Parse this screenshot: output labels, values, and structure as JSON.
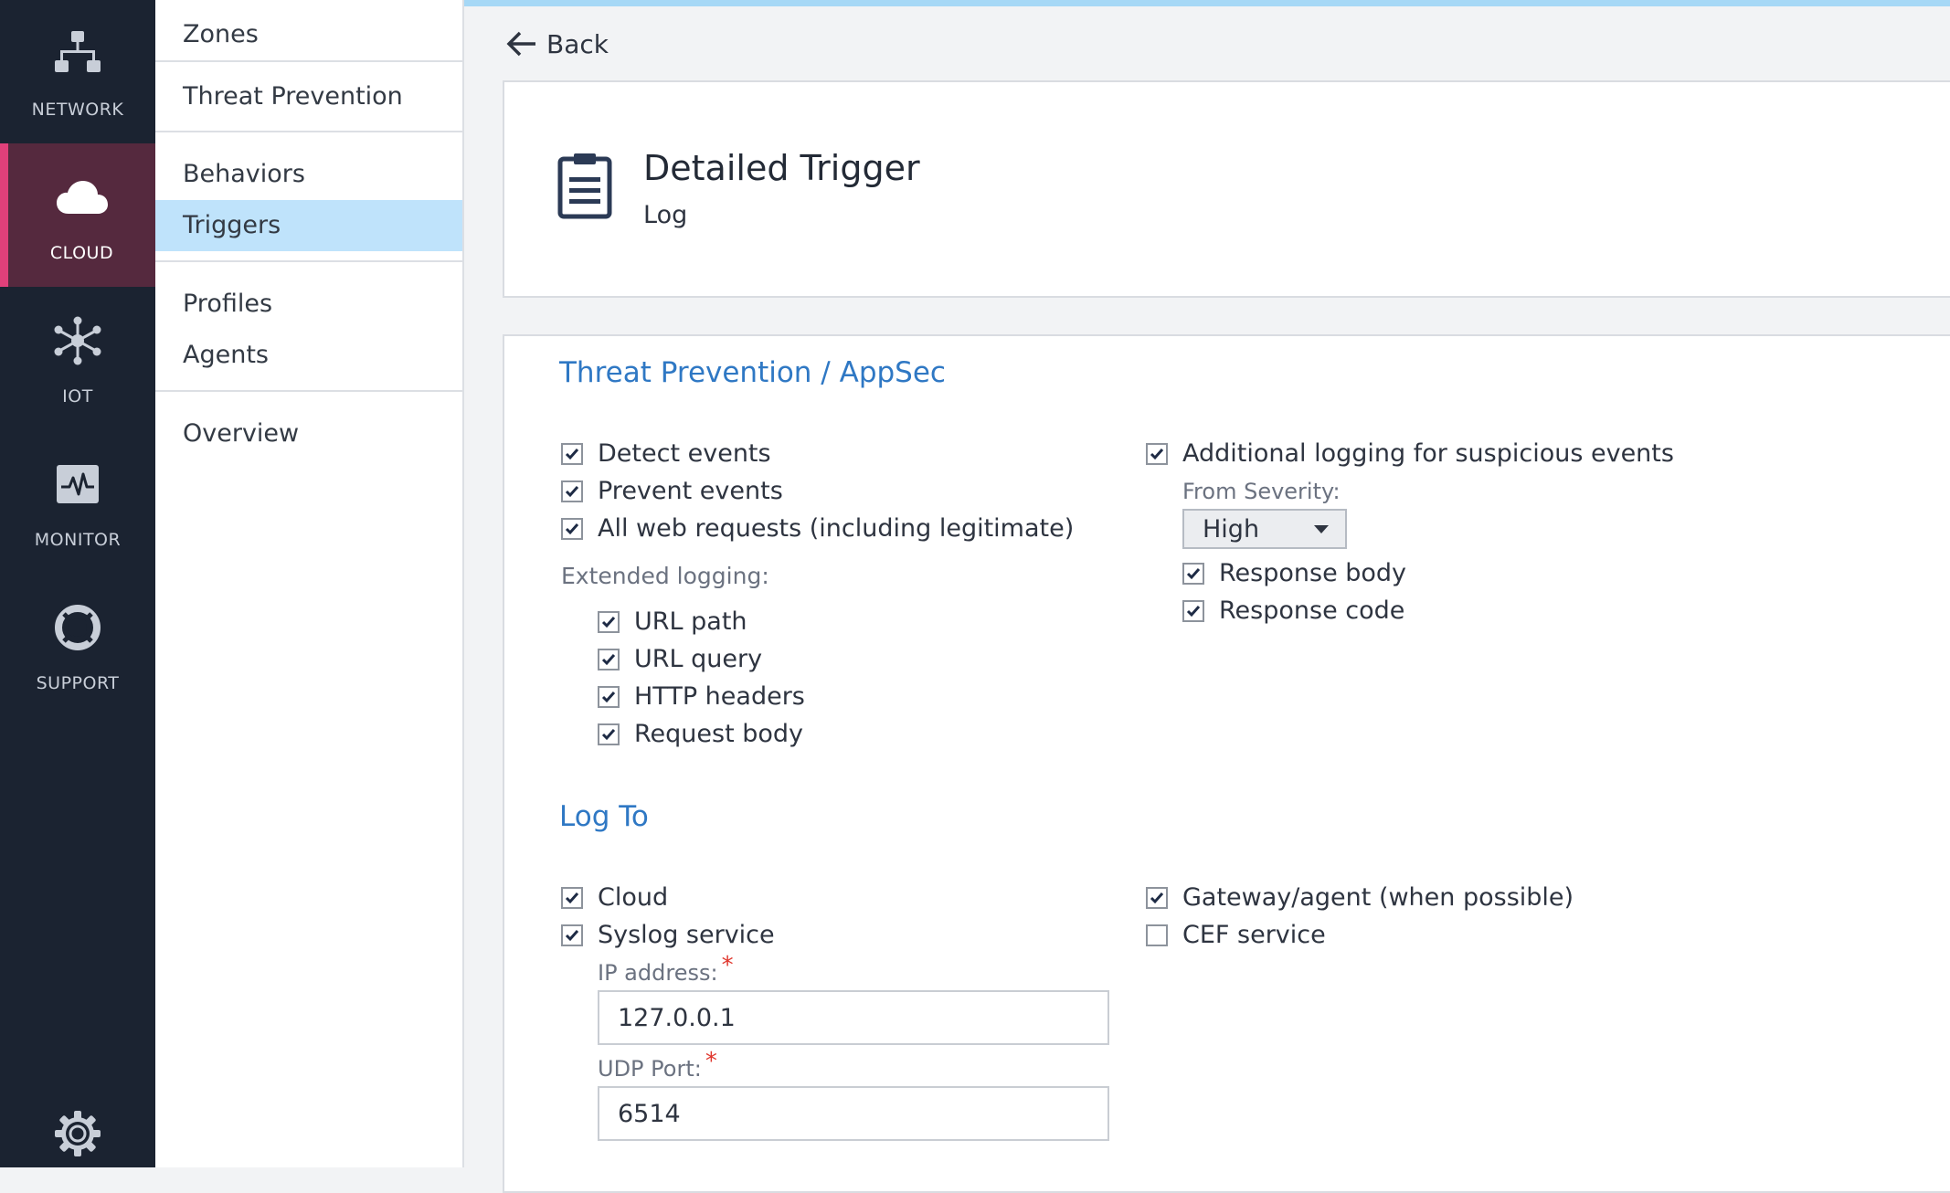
{
  "rail": {
    "items": [
      {
        "label": "NETWORK",
        "icon": "network-icon"
      },
      {
        "label": "CLOUD",
        "icon": "cloud-icon",
        "active": true
      },
      {
        "label": "IOT",
        "icon": "iot-icon"
      },
      {
        "label": "MONITOR",
        "icon": "monitor-icon"
      },
      {
        "label": "SUPPORT",
        "icon": "support-icon"
      }
    ],
    "settings_icon": "gear-icon",
    "active_color": "#e0407a"
  },
  "subnav": {
    "items": [
      "Zones",
      "Threat Prevention",
      "Behaviors",
      "Triggers",
      "Profiles",
      "Agents",
      "Overview"
    ],
    "selected": "Triggers"
  },
  "header": {
    "back_label": "Back",
    "title": "Detailed Trigger",
    "subtitle": "Log",
    "icon": "clipboard-icon"
  },
  "threat_prevention": {
    "title": "Threat Prevention / AppSec",
    "detect_events": "Detect events",
    "prevent_events": "Prevent events",
    "all_web_requests": "All web requests (including legitimate)",
    "extended_logging_label": "Extended logging:",
    "url_path": "URL path",
    "url_query": "URL query",
    "http_headers": "HTTP headers",
    "request_body": "Request body",
    "additional_logging": "Additional logging for suspicious events",
    "from_severity_label": "From Severity:",
    "severity_value": "High",
    "response_body": "Response body",
    "response_code": "Response code"
  },
  "log_to": {
    "title": "Log To",
    "cloud": "Cloud",
    "syslog_service": "Syslog service",
    "ip_address_label": "IP address:",
    "ip_address_value": "127.0.0.1",
    "udp_port_label": "UDP Port:",
    "udp_port_value": "6514",
    "gateway_agent": "Gateway/agent (when possible)",
    "cef_service": "CEF service",
    "required_mark": "*"
  },
  "colors": {
    "accent_link": "#2f78c4",
    "rail_bg": "#1b2331",
    "selected_nav_bg": "#bfe3fb",
    "top_bar": "#a6d8f6"
  }
}
